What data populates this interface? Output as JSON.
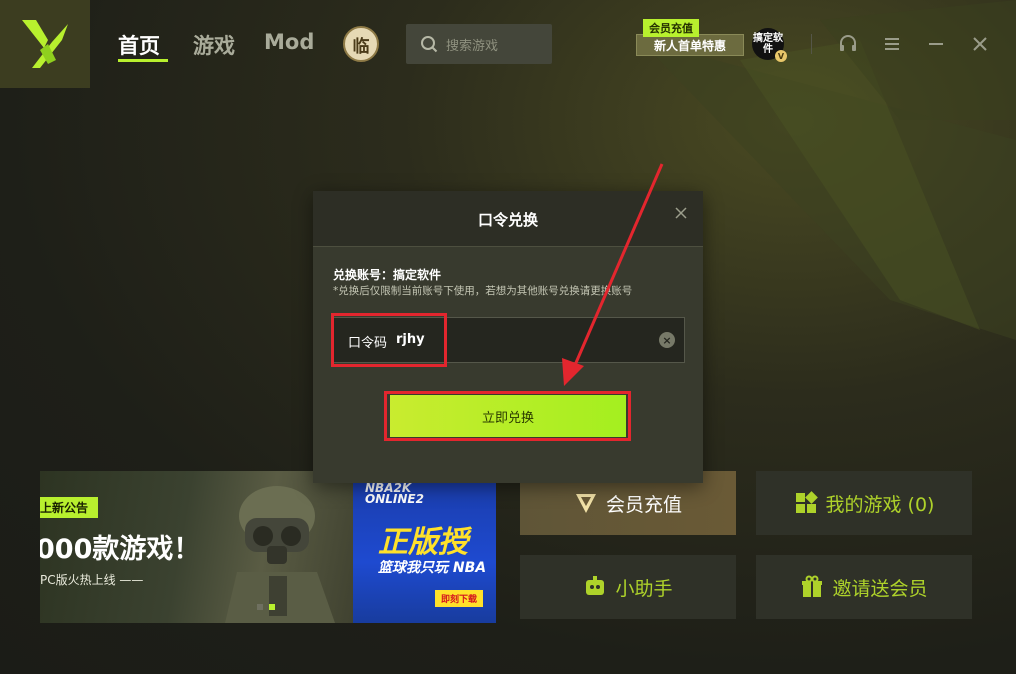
{
  "colors": {
    "accent": "#b8f02e",
    "highlight": "#e3262e",
    "background": "#1e1f18"
  },
  "nav": {
    "items": [
      {
        "label": "首页",
        "active": true
      },
      {
        "label": "游戏",
        "active": false
      },
      {
        "label": "Mod",
        "active": false
      }
    ],
    "badge": "临",
    "search_placeholder": "搜索游戏"
  },
  "promo": {
    "tag": "会员充值",
    "text": "新人首单特惠"
  },
  "user": {
    "avatar_text": "搞定软件",
    "vip_badge": "V"
  },
  "modal": {
    "title": "口令兑换",
    "account": "兑换账号：搞定软件",
    "note": "*兑换后仅限制当前账号下使用，若想为其他账号兑换请更换账号",
    "code_label": "口令码",
    "code_value": "rjhy",
    "redeem_label": "立即兑换"
  },
  "banner": {
    "tag": "上新公告",
    "headline": "000款游戏！",
    "sub": "PC版火热上线 ——",
    "nba_logo_top": "NBA2K",
    "nba_logo_bottom": "ONLINE2",
    "right_title": "正版授",
    "right_line": "篮球我只玩 NBA",
    "download": "即刻下载"
  },
  "cards": [
    {
      "label": "会员充值",
      "icon": "vip-icon"
    },
    {
      "label": "我的游戏 (0)",
      "icon": "grid-icon"
    },
    {
      "label": "小助手",
      "icon": "robot-icon"
    },
    {
      "label": "邀请送会员",
      "icon": "gift-icon"
    }
  ]
}
